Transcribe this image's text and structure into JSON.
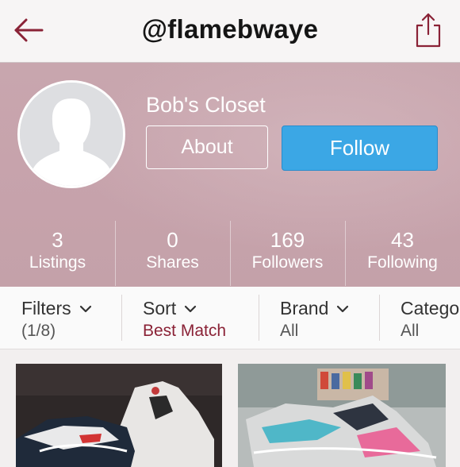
{
  "nav": {
    "title": "@flamebwaye",
    "back_icon": "arrow-left-icon",
    "share_icon": "share-icon",
    "accent": "#8a2236"
  },
  "profile": {
    "closet_name": "Bob's Closet",
    "about_label": "About",
    "follow_label": "Follow",
    "follow_color": "#3ba7e5",
    "cover_color": "#c7a3ac",
    "avatar_icon": "default-avatar-icon"
  },
  "stats": [
    {
      "value": "3",
      "label": "Listings"
    },
    {
      "value": "0",
      "label": "Shares"
    },
    {
      "value": "169",
      "label": "Followers"
    },
    {
      "value": "43",
      "label": "Following"
    }
  ],
  "filters": [
    {
      "name": "Filters",
      "value": "(1/8)"
    },
    {
      "name": "Sort",
      "value": "Best Match"
    },
    {
      "name": "Brand",
      "value": "All"
    },
    {
      "name": "Catego",
      "value": "All"
    }
  ],
  "listings": [
    {
      "icon": "sneaker-photo"
    },
    {
      "icon": "sneaker-photo"
    }
  ]
}
